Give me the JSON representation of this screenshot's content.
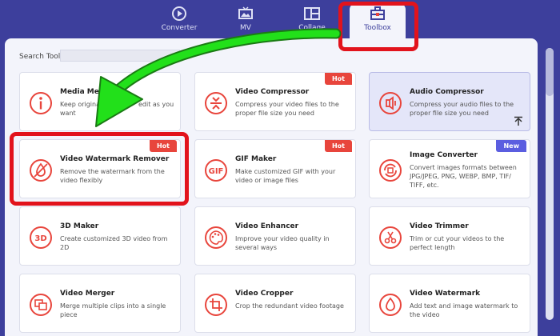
{
  "nav": {
    "tabs": [
      {
        "label": "Converter",
        "icon": "converter-icon"
      },
      {
        "label": "MV",
        "icon": "mv-icon"
      },
      {
        "label": "Collage",
        "icon": "collage-icon"
      },
      {
        "label": "Toolbox",
        "icon": "toolbox-icon",
        "active": true
      }
    ]
  },
  "search": {
    "label": "Search Tool:",
    "value": ""
  },
  "tools": [
    {
      "title": "Media Metad",
      "desc": "Keep original                  edit as you want",
      "icon": "info-icon"
    },
    {
      "title": "Video Compressor",
      "desc": "Compress your video files to the proper file size you need",
      "badge": "Hot",
      "icon": "compress-icon"
    },
    {
      "title": "Audio Compressor",
      "desc": "Compress your audio files to the proper file size you need",
      "icon": "audio-compress-icon"
    },
    {
      "title": "Video Watermark Remover",
      "desc": "Remove the watermark from the video flexibly",
      "badge": "Hot",
      "icon": "watermark-remove-icon"
    },
    {
      "title": "GIF Maker",
      "desc": "Make customized GIF with your video or image files",
      "badge": "Hot",
      "icon": "gif-icon"
    },
    {
      "title": "Image Converter",
      "desc": "Convert images formats between JPG/JPEG, PNG, WEBP, BMP, TIF/ TIFF, etc.",
      "badge": "New",
      "icon": "image-convert-icon"
    },
    {
      "title": "3D Maker",
      "desc": "Create customized 3D video from 2D",
      "icon": "3d-icon"
    },
    {
      "title": "Video Enhancer",
      "desc": "Improve your video quality in several ways",
      "icon": "palette-icon"
    },
    {
      "title": "Video Trimmer",
      "desc": "Trim or cut your videos to the perfect length",
      "icon": "scissors-icon"
    },
    {
      "title": "Video Merger",
      "desc": "Merge multiple clips into a single piece",
      "icon": "merge-icon"
    },
    {
      "title": "Video Cropper",
      "desc": "Crop the redundant video footage",
      "icon": "crop-icon"
    },
    {
      "title": "Video Watermark",
      "desc": "Add text and image watermark to the video",
      "icon": "droplet-icon"
    }
  ],
  "colors": {
    "accent": "#e8453c",
    "nav_bg": "#3d3f9c",
    "panel_bg": "#f3f4fb",
    "highlight": "#e2131c",
    "arrow": "#22e01a",
    "new_badge": "#5b5ee0"
  }
}
